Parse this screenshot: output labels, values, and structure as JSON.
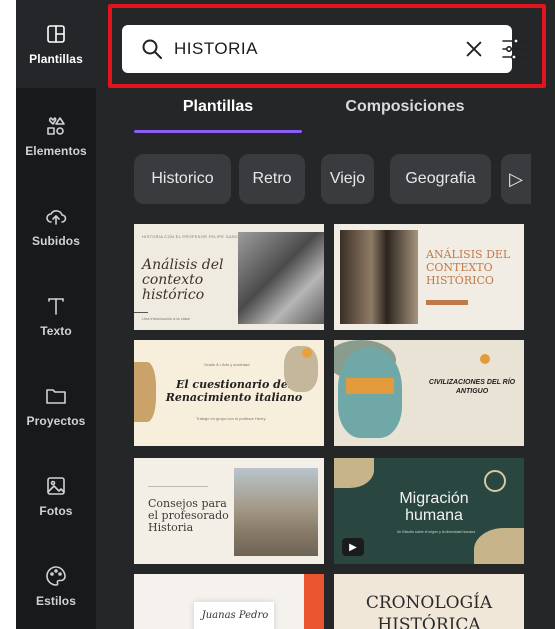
{
  "sidebar": {
    "items": [
      {
        "label": "Plantillas",
        "icon": "layout-icon"
      },
      {
        "label": "Elementos",
        "icon": "shapes-icon"
      },
      {
        "label": "Subidos",
        "icon": "cloud-upload-icon"
      },
      {
        "label": "Texto",
        "icon": "text-icon"
      },
      {
        "label": "Proyectos",
        "icon": "folder-icon"
      },
      {
        "label": "Fotos",
        "icon": "image-icon"
      },
      {
        "label": "Estilos",
        "icon": "palette-icon"
      }
    ]
  },
  "search": {
    "value": "HISTORIA"
  },
  "tabs": [
    {
      "label": "Plantillas",
      "active": true
    },
    {
      "label": "Composiciones",
      "active": false
    }
  ],
  "chips": [
    "Historico",
    "Retro",
    "Viejo",
    "Geografia"
  ],
  "templates": [
    {
      "title": "Análisis del contexto histórico",
      "header": "HISTORIA CON EL PROFESOR FELIPE GARCÍA",
      "subtitle": "Una introducción a la clase"
    },
    {
      "title": "ANÁLISIS DEL CONTEXTO HISTÓRICO"
    },
    {
      "title": "El cuestionario del Renacimiento italiano",
      "header": "Grado 8 • Arte y sociedad",
      "subtitle": "Trabajo en grupo con el profesor Henry"
    },
    {
      "title": "CIVILIZACIONES DEL RÍO ANTIGUO"
    },
    {
      "title": "Consejos para el profesorado Historia"
    },
    {
      "title": "Migración humana",
      "subtitle": "Un Estudio sobre el origen y la diversidad humana"
    },
    {
      "title": "Juanas Pedro"
    },
    {
      "title": "CRONOLOGÍA HISTÓRICA"
    }
  ],
  "colors": {
    "accent": "#8b5cf6",
    "highlight": "#e3131b",
    "panel": "#252627",
    "rail": "#18191b"
  }
}
